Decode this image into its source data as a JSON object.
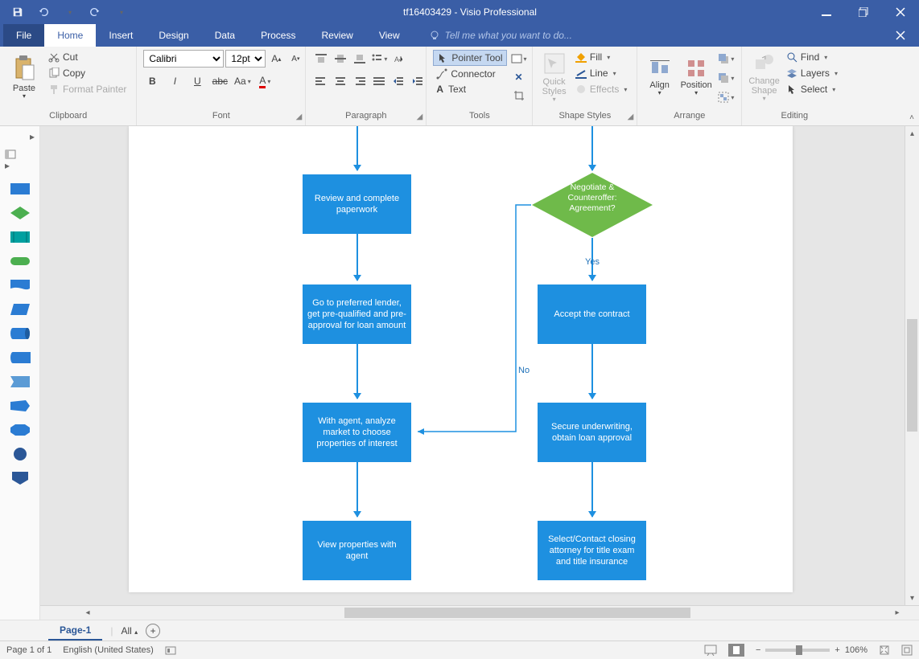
{
  "titlebar": {
    "doc": "tf16403429",
    "app": "Visio Professional"
  },
  "menubar": {
    "file": "File",
    "home": "Home",
    "insert": "Insert",
    "design": "Design",
    "data": "Data",
    "process": "Process",
    "review": "Review",
    "view": "View",
    "tellme": "Tell me what you want to do..."
  },
  "ribbon": {
    "clipboard": {
      "label": "Clipboard",
      "paste": "Paste",
      "cut": "Cut",
      "copy": "Copy",
      "format_painter": "Format Painter"
    },
    "font": {
      "label": "Font",
      "name": "Calibri",
      "size": "12pt."
    },
    "paragraph": {
      "label": "Paragraph"
    },
    "tools": {
      "label": "Tools",
      "pointer": "Pointer Tool",
      "connector": "Connector",
      "text": "Text"
    },
    "shapestyles": {
      "label": "Shape Styles",
      "quick": "Quick Styles",
      "fill": "Fill",
      "line": "Line",
      "effects": "Effects"
    },
    "arrange": {
      "label": "Arrange",
      "align": "Align",
      "position": "Position"
    },
    "editing": {
      "label": "Editing",
      "change": "Change Shape",
      "find": "Find",
      "layers": "Layers",
      "select": "Select"
    }
  },
  "flow": {
    "review": "Review and complete paperwork",
    "lender": "Go to preferred lender, get pre-qualified and pre-approval for loan amount",
    "analyze": "With agent, analyze market to choose properties of interest",
    "view": "View properties with agent",
    "negotiate": "Negotiate & Counteroffer: Agreement?",
    "yes": "Yes",
    "no": "No",
    "accept": "Accept the contract",
    "secure": "Secure underwriting, obtain loan approval",
    "attorney": "Select/Contact closing attorney for title exam and title insurance"
  },
  "pagetabs": {
    "page1": "Page-1",
    "all": "All"
  },
  "status": {
    "page": "Page 1 of 1",
    "lang": "English (United States)",
    "zoom": "106%"
  }
}
